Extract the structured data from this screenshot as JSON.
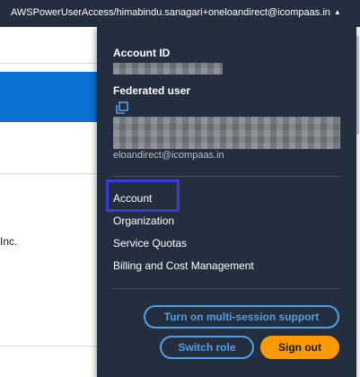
{
  "topbar": {
    "account_label": "AWSPowerUserAccess/himabindu.sanagari+oneloandirect@icompaas.in",
    "caret": "▲"
  },
  "background": {
    "text_inc": "Inc."
  },
  "panel": {
    "account_id_label": "Account ID",
    "federated_user_label": "Federated user",
    "email_tail": "eloandirect@icompaas.in",
    "menu": {
      "account": "Account",
      "organization": "Organization",
      "service_quotas": "Service Quotas",
      "billing": "Billing and Cost Management"
    },
    "buttons": {
      "multi_session": "Turn on multi-session support",
      "switch_role": "Switch role",
      "sign_out": "Sign out"
    }
  },
  "icons": {
    "copy": "copy-icon",
    "caret": "caret-up-icon"
  },
  "colors": {
    "panel_bg": "#232f3e",
    "accent_blue": "#539fe5",
    "sign_out_orange": "#ff9900",
    "highlight_box": "#3b3bd6"
  }
}
